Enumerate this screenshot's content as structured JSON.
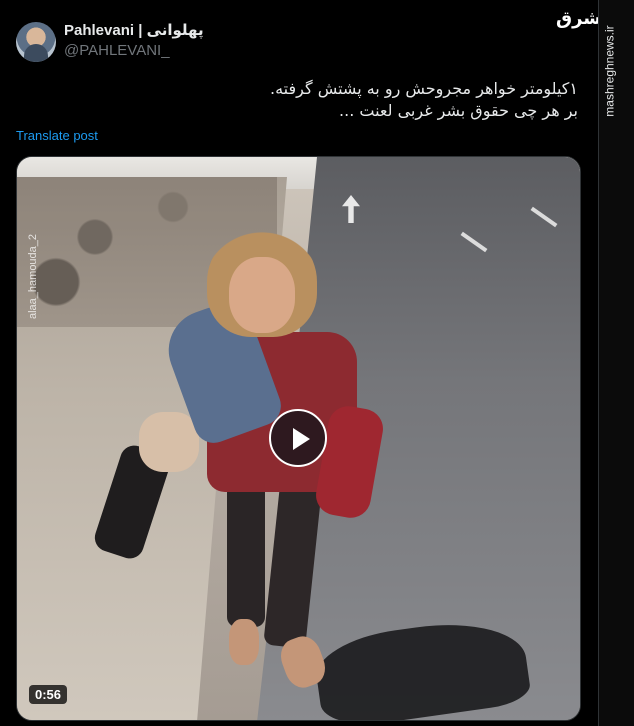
{
  "author": {
    "display_name": "Pahlevani | پهلوانی",
    "handle": "@PAHLEVANI_",
    "avatar_icon": "user-avatar-icon"
  },
  "brand": {
    "logo_text": "مشرق",
    "site": "mashreghnews.ir"
  },
  "tweet": {
    "lines": [
      "۱کیلومتر خواهر مجروحش رو به پشتش گرفته.",
      "بر هر چی حقوق بشر غربی لعنت ..."
    ],
    "translate_label": "Translate post"
  },
  "media": {
    "watermark": "alaa_hamouda_2",
    "duration": "0:56",
    "play_icon": "play-icon"
  },
  "colors": {
    "background": "#000000",
    "text": "#e7e9ea",
    "secondary_text": "#71767b",
    "link": "#1d9bf0"
  }
}
